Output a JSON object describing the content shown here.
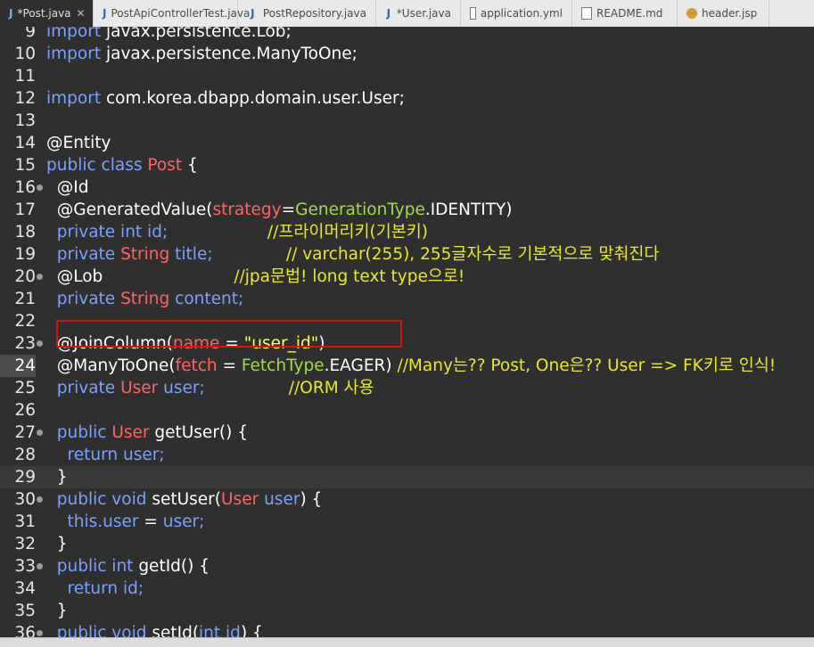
{
  "tabs": [
    {
      "label": "*Post.java",
      "icon": "java-file-icon",
      "active": true
    },
    {
      "label": "PostApiControllerTest.java",
      "icon": "java-file-icon"
    },
    {
      "label": "PostRepository.java",
      "icon": "java-file-icon"
    },
    {
      "label": "*User.java",
      "icon": "java-file-icon"
    },
    {
      "label": "application.yml",
      "icon": "yaml-file-icon"
    },
    {
      "label": "README.md",
      "icon": "markdown-file-icon"
    },
    {
      "label": "header.jsp",
      "icon": "jsp-file-icon"
    }
  ],
  "lines": [
    {
      "n": "9",
      "tokens": [
        {
          "t": "import ",
          "c": "k"
        },
        {
          "t": "javax.persistence.Lob;",
          "c": "p"
        }
      ]
    },
    {
      "n": "10",
      "tokens": [
        {
          "t": "import ",
          "c": "k"
        },
        {
          "t": "javax.persistence.ManyToOne;",
          "c": "p"
        }
      ]
    },
    {
      "n": "11",
      "tokens": []
    },
    {
      "n": "12",
      "tokens": [
        {
          "t": "import ",
          "c": "k"
        },
        {
          "t": "com.korea.dbapp.domain.user.User;",
          "c": "p"
        }
      ]
    },
    {
      "n": "13",
      "tokens": []
    },
    {
      "n": "14",
      "tokens": [
        {
          "t": "@Entity",
          "c": "ann"
        }
      ]
    },
    {
      "n": "15",
      "tokens": [
        {
          "t": "public class ",
          "c": "k"
        },
        {
          "t": "Post",
          "c": "cls"
        },
        {
          "t": " {",
          "c": "p"
        }
      ]
    },
    {
      "n": "16",
      "fold": true,
      "tokens": [
        {
          "t": "  @Id",
          "c": "ann"
        }
      ]
    },
    {
      "n": "17",
      "tokens": [
        {
          "t": "  @GeneratedValue(",
          "c": "ann"
        },
        {
          "t": "strategy",
          "c": "prm"
        },
        {
          "t": "=",
          "c": "p"
        },
        {
          "t": "GenerationType",
          "c": "typ"
        },
        {
          "t": ".IDENTITY)",
          "c": "p"
        }
      ]
    },
    {
      "n": "18",
      "tokens": [
        {
          "t": "  private int ",
          "c": "k"
        },
        {
          "t": "id;",
          "c": "fld"
        },
        {
          "t": "                   //프라이머리키(기본키)",
          "c": "cm"
        }
      ]
    },
    {
      "n": "19",
      "tokens": [
        {
          "t": "  private ",
          "c": "k"
        },
        {
          "t": "String ",
          "c": "cls"
        },
        {
          "t": "title;",
          "c": "fld"
        },
        {
          "t": "              // varchar(255), 255글자수로 기본적으로 맞춰진다",
          "c": "cm"
        }
      ]
    },
    {
      "n": "20",
      "fold": true,
      "tokens": [
        {
          "t": "  @Lob",
          "c": "ann"
        },
        {
          "t": "                         //jpa문법! long text type으로!",
          "c": "cm"
        }
      ]
    },
    {
      "n": "21",
      "tokens": [
        {
          "t": "  private ",
          "c": "k"
        },
        {
          "t": "String ",
          "c": "cls"
        },
        {
          "t": "content;",
          "c": "fld"
        }
      ]
    },
    {
      "n": "22",
      "tokens": []
    },
    {
      "n": "23",
      "fold": true,
      "tokens": [
        {
          "t": "  @JoinColumn(",
          "c": "ann"
        },
        {
          "t": "name",
          "c": "prm"
        },
        {
          "t": " = ",
          "c": "p"
        },
        {
          "t": "\"user_id\"",
          "c": "str"
        },
        {
          "t": ")",
          "c": "p"
        }
      ]
    },
    {
      "n": "24",
      "hl": true,
      "tokens": [
        {
          "t": "  @ManyToOne(",
          "c": "ann"
        },
        {
          "t": "fetch",
          "c": "prm"
        },
        {
          "t": " = ",
          "c": "p"
        },
        {
          "t": "FetchType",
          "c": "typ"
        },
        {
          "t": ".EAGER)",
          "c": "p"
        },
        {
          "t": " //Many는?? Post, One은?? User => FK키로 인식!",
          "c": "cm"
        }
      ]
    },
    {
      "n": "25",
      "tokens": [
        {
          "t": "  private ",
          "c": "k"
        },
        {
          "t": "User ",
          "c": "cls"
        },
        {
          "t": "user;",
          "c": "fld"
        },
        {
          "t": "                //ORM 사용",
          "c": "cm"
        }
      ]
    },
    {
      "n": "26",
      "tokens": []
    },
    {
      "n": "27",
      "fold": true,
      "tokens": [
        {
          "t": "  public ",
          "c": "k"
        },
        {
          "t": "User ",
          "c": "cls"
        },
        {
          "t": "getUser() {",
          "c": "p"
        }
      ]
    },
    {
      "n": "28",
      "tokens": [
        {
          "t": "    return ",
          "c": "k"
        },
        {
          "t": "user;",
          "c": "fld"
        }
      ]
    },
    {
      "n": "29",
      "current": true,
      "tokens": [
        {
          "t": "  }",
          "c": "p"
        }
      ]
    },
    {
      "n": "30",
      "fold": true,
      "tokens": [
        {
          "t": "  public void ",
          "c": "k"
        },
        {
          "t": "setUser(",
          "c": "p"
        },
        {
          "t": "User ",
          "c": "cls"
        },
        {
          "t": "user",
          "c": "fld"
        },
        {
          "t": ") {",
          "c": "p"
        }
      ]
    },
    {
      "n": "31",
      "tokens": [
        {
          "t": "    this.",
          "c": "k"
        },
        {
          "t": "user",
          "c": "fld"
        },
        {
          "t": " = ",
          "c": "p"
        },
        {
          "t": "user;",
          "c": "fld"
        }
      ]
    },
    {
      "n": "32",
      "tokens": [
        {
          "t": "  }",
          "c": "p"
        }
      ]
    },
    {
      "n": "33",
      "fold": true,
      "tokens": [
        {
          "t": "  public int ",
          "c": "k"
        },
        {
          "t": "getId() {",
          "c": "p"
        }
      ]
    },
    {
      "n": "34",
      "tokens": [
        {
          "t": "    return ",
          "c": "k"
        },
        {
          "t": "id;",
          "c": "fld"
        }
      ]
    },
    {
      "n": "35",
      "tokens": [
        {
          "t": "  }",
          "c": "p"
        }
      ]
    },
    {
      "n": "36",
      "fold": true,
      "tokens": [
        {
          "t": "  public void ",
          "c": "k"
        },
        {
          "t": "setId(",
          "c": "p"
        },
        {
          "t": "int ",
          "c": "k"
        },
        {
          "t": "id",
          "c": "fld"
        },
        {
          "t": ") {",
          "c": "p"
        }
      ]
    }
  ]
}
